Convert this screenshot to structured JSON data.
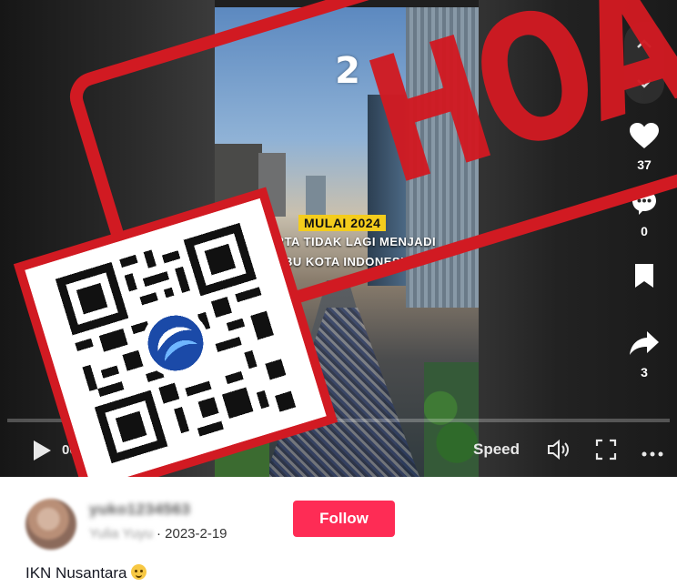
{
  "video": {
    "channel_logo": "2",
    "caption_tag": "MULAI 2024",
    "caption_line1": "KARTA TIDAK LAGI MENJADI",
    "caption_line2": "IBU KOTA INDONESIA"
  },
  "stamp": {
    "text": "HOAKS",
    "color": "#d11a22"
  },
  "actions": {
    "likes": "37",
    "comments": "0",
    "shares": "3"
  },
  "controls": {
    "time": "00:0",
    "speed_label": "Speed"
  },
  "author": {
    "username": "yuko1234563",
    "nickname": "Yulia Yuyu",
    "date": "· 2023-2-19"
  },
  "follow_label": "Follow",
  "description": "IKN Nusantara",
  "colors": {
    "follow": "#fe2c55",
    "stamp": "#d11a22",
    "caption_tag": "#f4cc1c"
  }
}
